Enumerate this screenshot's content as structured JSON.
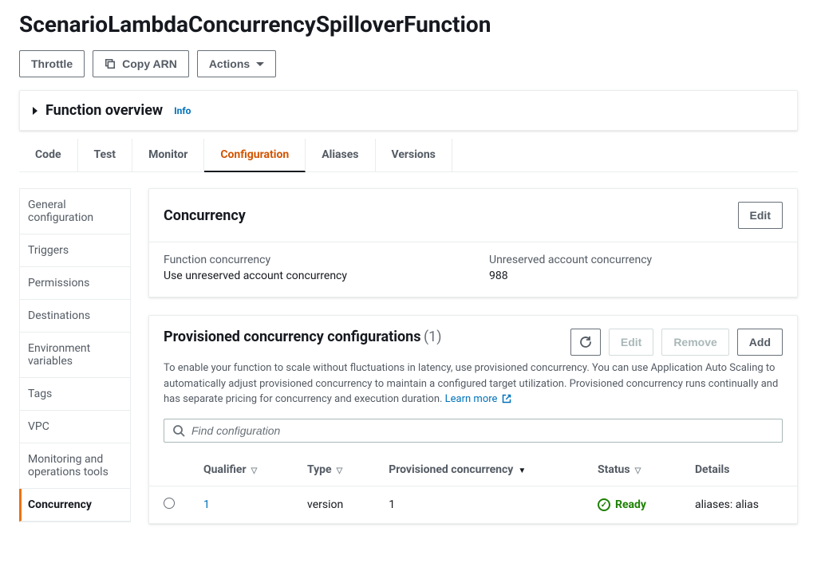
{
  "page_title": "ScenarioLambdaConcurrencySpilloverFunction",
  "toolbar": {
    "throttle": "Throttle",
    "copy_arn": "Copy ARN",
    "actions": "Actions"
  },
  "overview": {
    "title": "Function overview",
    "info": "Info"
  },
  "tabs": [
    "Code",
    "Test",
    "Monitor",
    "Configuration",
    "Aliases",
    "Versions"
  ],
  "active_tab": "Configuration",
  "sidenav": [
    "General configuration",
    "Triggers",
    "Permissions",
    "Destinations",
    "Environment variables",
    "Tags",
    "VPC",
    "Monitoring and operations tools",
    "Concurrency"
  ],
  "active_sidenav": "Concurrency",
  "concurrency_panel": {
    "title": "Concurrency",
    "edit": "Edit",
    "fn_label": "Function concurrency",
    "fn_value": "Use unreserved account concurrency",
    "unres_label": "Unreserved account concurrency",
    "unres_value": "988"
  },
  "provisioned_panel": {
    "title": "Provisioned concurrency configurations",
    "count": "(1)",
    "buttons": {
      "edit": "Edit",
      "remove": "Remove",
      "add": "Add"
    },
    "description": "To enable your function to scale without fluctuations in latency, use provisioned concurrency. You can use Application Auto Scaling to automatically adjust provisioned concurrency to maintain a configured target utilization. Provisioned concurrency runs continually and has separate pricing for concurrency and execution duration.",
    "learn_more": "Learn more",
    "filter_placeholder": "Find configuration",
    "columns": {
      "qualifier": "Qualifier",
      "type": "Type",
      "provisioned": "Provisioned concurrency",
      "status": "Status",
      "details": "Details"
    },
    "row": {
      "qualifier": "1",
      "type": "version",
      "provisioned": "1",
      "status": "Ready",
      "details": "aliases: alias"
    }
  }
}
